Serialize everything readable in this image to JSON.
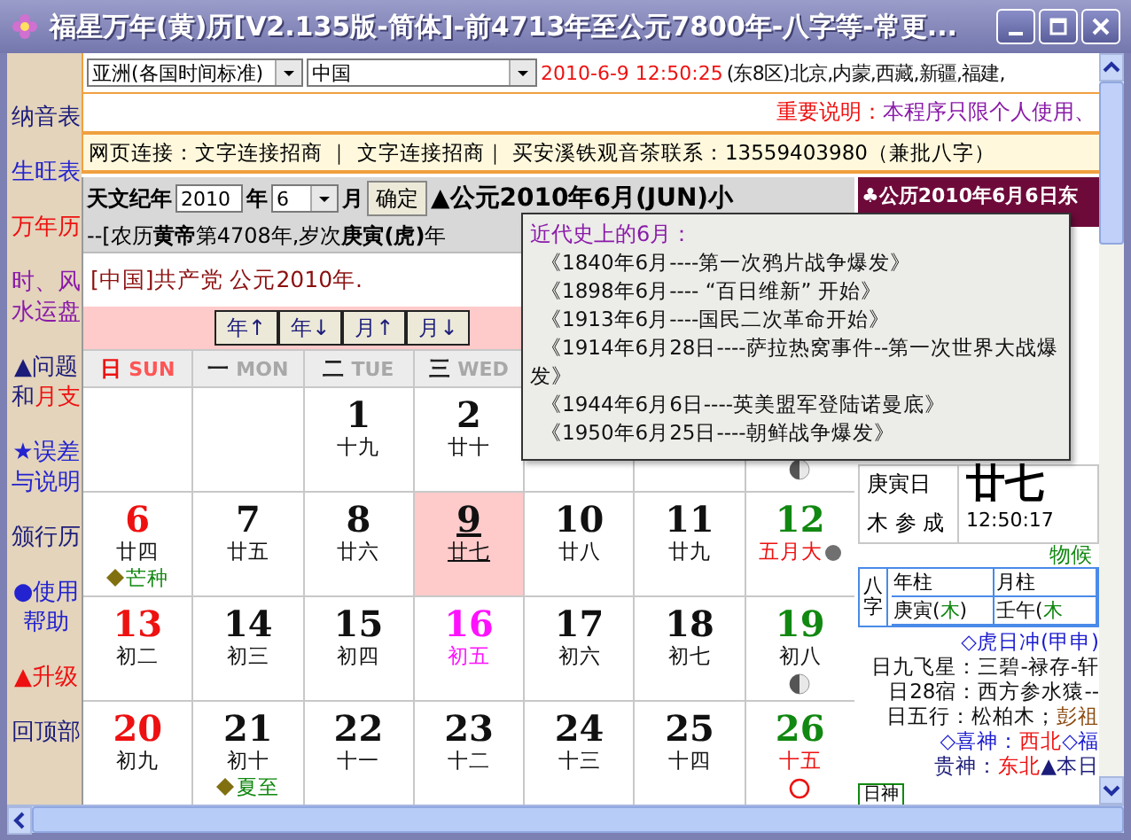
{
  "window": {
    "title": "福星万年(黄)历[V2.135版-简体]-前4713年至公元7800年-八字等-常更..."
  },
  "sidebar": {
    "items": [
      {
        "parts": [
          {
            "text": "纳音表",
            "color": "#1c1c7a"
          }
        ]
      },
      {
        "parts": [
          {
            "text": "生旺表",
            "color": "#2323d0"
          }
        ]
      },
      {
        "parts": [
          {
            "text": "万年历",
            "color": "#ee1111"
          }
        ]
      },
      {
        "parts": [
          {
            "text": "时、风水运盘",
            "color": "#8a1aa8"
          }
        ]
      },
      {
        "parts": [
          {
            "text": "▲问题和",
            "color": "#1c1c7a"
          },
          {
            "text": "月支",
            "color": "#ee1111"
          }
        ]
      },
      {
        "parts": [
          {
            "text": "★误差与说明",
            "color": "#2323d0"
          }
        ]
      },
      {
        "parts": [
          {
            "text": "颁行历",
            "color": "#1c1c7a"
          }
        ]
      },
      {
        "parts": [
          {
            "text": "●使用帮助",
            "color": "#2323d0"
          }
        ]
      },
      {
        "parts": [
          {
            "text": "▲升级",
            "color": "#ee1111"
          }
        ]
      },
      {
        "parts": [
          {
            "text": "回顶部",
            "color": "#1c1c7a"
          }
        ]
      }
    ]
  },
  "location": {
    "region": "亚洲(各国时间标准)",
    "country": "中国",
    "datetime": "2010-6-9 12:50:25",
    "zone": "(东8区)北京,内蒙,西藏,新疆,福建,"
  },
  "notice": {
    "label": "重要说明：",
    "text": "本程序只限个人使用、"
  },
  "links": {
    "text": "网页连接：文字连接招商 ｜ 文字连接招商｜ 买安溪铁观音茶联系：13559403980（兼批八字）"
  },
  "calendar": {
    "year_label": "天文纪年",
    "year": "2010",
    "year_unit": "年",
    "month": "6",
    "month_unit": "月",
    "confirm": "确定",
    "heading": "▲公元2010年6月(JUN)小",
    "lunar_line": "--[农历**黄帝**第4708年,岁次**庚寅(虎)**年",
    "party_note": "[中国]共产党 公元2010年.",
    "nav_buttons": [
      "年↑",
      "年↓",
      "月↑",
      "月↓"
    ],
    "weekdays": [
      {
        "cn": "日",
        "en": "SUN",
        "kind": "sunday"
      },
      {
        "cn": "一",
        "en": "MON",
        "kind": "weekday"
      },
      {
        "cn": "二",
        "en": "TUE",
        "kind": "weekday"
      },
      {
        "cn": "三",
        "en": "WED",
        "kind": "weekday"
      }
    ],
    "weeks": [
      [
        {
          "kind": "empty"
        },
        {
          "kind": "empty"
        },
        {
          "day": "1",
          "lunar": "十九",
          "kind": "weekday",
          "selected": false
        },
        {
          "day": "2",
          "lunar": "廿十",
          "kind": "weekday",
          "selected": false
        },
        {
          "kind": "empty"
        },
        {
          "kind": "empty"
        },
        {
          "kind": "empty",
          "moon": {
            "kind": "quarter"
          }
        }
      ],
      [
        {
          "day": "6",
          "lunar": "廿四",
          "kind": "sunday",
          "selected": false,
          "term": "芒种"
        },
        {
          "day": "7",
          "lunar": "廿五",
          "kind": "weekday",
          "selected": false
        },
        {
          "day": "8",
          "lunar": "廿六",
          "kind": "weekday",
          "selected": false
        },
        {
          "day": "9",
          "lunar": "廿七",
          "kind": "weekday",
          "selected": true
        },
        {
          "day": "10",
          "lunar": "廿八",
          "kind": "weekday",
          "selected": false
        },
        {
          "day": "11",
          "lunar": "廿九",
          "kind": "weekday",
          "selected": false
        },
        {
          "day": "12",
          "lunar": "五月大",
          "kind": "saturday",
          "selected": false,
          "lunar_red": true,
          "moon": {
            "kind": "new"
          }
        }
      ],
      [
        {
          "day": "13",
          "lunar": "初二",
          "kind": "sunday",
          "selected": false
        },
        {
          "day": "14",
          "lunar": "初三",
          "kind": "weekday",
          "selected": false
        },
        {
          "day": "15",
          "lunar": "初四",
          "kind": "weekday",
          "selected": false
        },
        {
          "day": "16",
          "lunar": "初五",
          "kind": "festival",
          "selected": false
        },
        {
          "day": "17",
          "lunar": "初六",
          "kind": "weekday",
          "selected": false
        },
        {
          "day": "18",
          "lunar": "初七",
          "kind": "weekday",
          "selected": false
        },
        {
          "day": "19",
          "lunar": "初八",
          "kind": "saturday",
          "selected": false,
          "moon": {
            "kind": "quarter"
          }
        }
      ],
      [
        {
          "day": "20",
          "lunar": "初九",
          "kind": "sunday",
          "selected": false
        },
        {
          "day": "21",
          "lunar": "初十",
          "kind": "weekday",
          "selected": false,
          "term": "夏至"
        },
        {
          "day": "22",
          "lunar": "十一",
          "kind": "weekday",
          "selected": false
        },
        {
          "day": "23",
          "lunar": "十二",
          "kind": "weekday",
          "selected": false
        },
        {
          "day": "24",
          "lunar": "十三",
          "kind": "weekday",
          "selected": false
        },
        {
          "day": "25",
          "lunar": "十四",
          "kind": "weekday",
          "selected": false
        },
        {
          "day": "26",
          "lunar": "十五",
          "kind": "saturday",
          "selected": false,
          "lunar_red": true,
          "moon": {
            "kind": "full"
          }
        }
      ]
    ]
  },
  "almanac": {
    "header": "♣公历2010年6月6日东",
    "ganzhi_day": "庚寅日",
    "lunar_day": "廿七",
    "mansion": "木 参 成",
    "time": "12:50:17",
    "phenology": "物候",
    "bazi": {
      "label": "八字",
      "headers": [
        "年柱",
        "月柱"
      ],
      "values": [
        [
          {
            "text": "庚寅(",
            "color": "#111111"
          },
          {
            "text": "木",
            "color": "#118811"
          },
          {
            "text": ")",
            "color": "#111111"
          }
        ],
        [
          {
            "text": "壬午(",
            "color": "#111111"
          },
          {
            "text": "木",
            "color": "#118811"
          }
        ]
      ]
    },
    "lines": [
      [
        {
          "text": "◇虎日冲(甲申)",
          "color": "#1a1ad0"
        }
      ],
      [
        {
          "text": "日九飞星：三碧-禄存-轩",
          "color": "#111111"
        }
      ],
      [
        {
          "text": "日28宿：西方参水猿--",
          "color": "#111111"
        }
      ],
      [
        {
          "text": "日五行：松柏木；",
          "color": "#111111"
        },
        {
          "text": "彭祖",
          "color": "#8a4a10"
        }
      ],
      [
        {
          "text": "◇喜神：",
          "color": "#1a1ad0"
        },
        {
          "text": "西北",
          "color": "#ee1111"
        },
        {
          "text": "◇福",
          "color": "#1a1ad0"
        }
      ],
      [
        {
          "text": "贵神：",
          "color": "#1c1c7a"
        },
        {
          "text": "东北",
          "color": "#ee1111"
        },
        {
          "text": "▲本日",
          "color": "#1c1c7a"
        }
      ]
    ],
    "footer": "日神"
  },
  "tooltip": {
    "title": "近代史上的6月：",
    "lines": [
      "《1840年6月----第一次鸦片战争爆发》",
      "《1898年6月---- “百日维新” 开始》",
      "《1913年6月----国民二次革命开始》",
      "《1914年6月28日----萨拉热窝事件--第一次世界大战爆发》",
      "《1944年6月6日----英美盟军登陆诺曼底》",
      "《1950年6月25日----朝鲜战争爆发》"
    ]
  }
}
